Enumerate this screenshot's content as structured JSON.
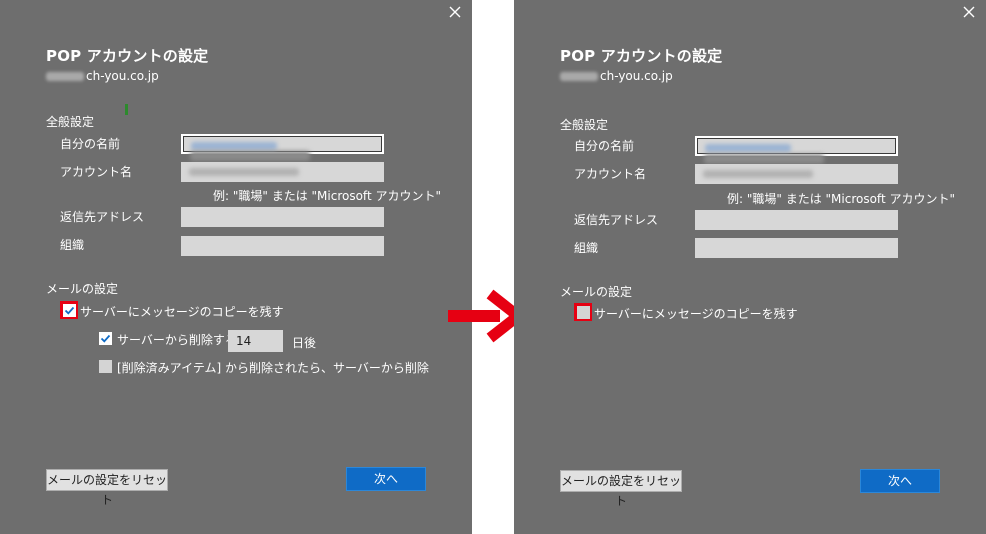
{
  "dialog": {
    "title": "POP アカウントの設定",
    "email_suffix": "ch-you.co.jp",
    "general_heading": "全般設定",
    "labels": {
      "your_name": "自分の名前",
      "account_name": "アカウント名",
      "reply_to": "返信先アドレス",
      "organization": "組織"
    },
    "account_hint": "例: \"職場\" または \"Microsoft アカウント\"",
    "mail_heading": "メールの設定",
    "leave_copy_label": "サーバーにメッセージのコピーを残す",
    "remove_after_label": "サーバーから削除する",
    "days_value": "14",
    "days_unit": "日後",
    "remove_deleted_label": "[削除済みアイテム] から削除されたら、サーバーから削除",
    "reset_button": "メールの設定をリセット",
    "next_button": "次へ"
  },
  "left_state": {
    "leave_copy_checked": true,
    "remove_after_checked": true,
    "remove_deleted_checked": false
  },
  "right_state": {
    "leave_copy_checked": false
  },
  "colors": {
    "panel_bg": "#6e6e6e",
    "field_bg": "#d7d7d7",
    "primary_button": "#0f6bc6",
    "highlight": "#e60012"
  },
  "icons": {
    "close": "close-icon",
    "arrow": "right-arrow-icon",
    "check": "check-icon"
  }
}
